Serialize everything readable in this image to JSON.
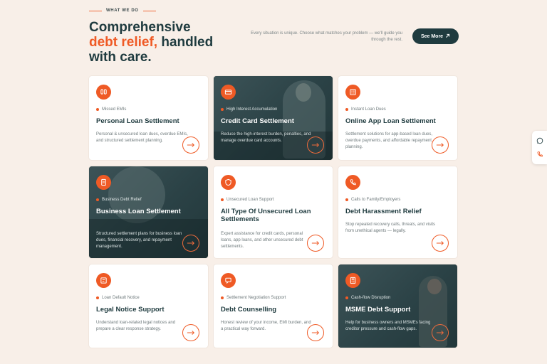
{
  "header": {
    "eyebrow": "WHAT WE DO",
    "title_line1": "Comprehensive",
    "title_accent": "debt relief,",
    "title_rest": " handled",
    "title_line3": "with care.",
    "intro": "Every situation is unique. Choose what matches your problem — we'll guide you through the rest.",
    "see_more": "See More"
  },
  "cards": [
    {
      "tag": "Missed EMIs",
      "title": "Personal Loan Settlement",
      "desc": "Personal & unsecured loan dues, overdue EMIs, and structured settlement planning.",
      "icon": "hands-icon"
    },
    {
      "tag": "High Interest Accumulation",
      "title": "Credit Card Settlement",
      "desc": "Reduce the high-interest burden, penalties, and manage overdue card accounts.",
      "icon": "credit-card-icon"
    },
    {
      "tag": "Instant Loan Dues",
      "title": "Online App Loan Settlement",
      "desc": "Settlement solutions for app-based loan dues, overdue payments, and affordable repayment planning.",
      "icon": "app-grid-icon"
    },
    {
      "tag": "Business Debt Relief",
      "title": "Business Loan Settlement",
      "desc": "Structured settlement plans for business loan dues, financial recovery, and repayment management.",
      "icon": "document-icon"
    },
    {
      "tag": "Unsecured Loan Support",
      "title": "All Type Of Unsecured Loan Settlements",
      "desc": "Expert assistance for credit cards, personal loans, app loans, and other unsecured debt settlements.",
      "icon": "shield-icon"
    },
    {
      "tag": "Calls to Family/Employers",
      "title": "Debt Harassment Relief",
      "desc": "Stop repeated recovery calls, threats, and visits from unethical agents — legally.",
      "icon": "phone-icon"
    },
    {
      "tag": "Loan Default Notice",
      "title": "Legal Notice Support",
      "desc": "Understand loan-related legal notices and prepare a clear response strategy.",
      "icon": "legal-document-icon"
    },
    {
      "tag": "Settlement Negotiation Support",
      "title": "Debt Counselling",
      "desc": "Honest review of your income, EMI burden, and a practical way forward.",
      "icon": "chat-icon"
    },
    {
      "tag": "Cash-flow Disruption",
      "title": "MSME Debt Support",
      "desc": "Help for business owners and MSMEs facing creditor pressure and cash-flow gaps.",
      "icon": "calculator-icon"
    }
  ],
  "float_bar": {
    "icons": [
      "whatsapp-icon",
      "phone-call-icon"
    ]
  },
  "colors": {
    "accent": "#ef5a25",
    "dark": "#1f3b3f",
    "background": "#f8efe8"
  }
}
